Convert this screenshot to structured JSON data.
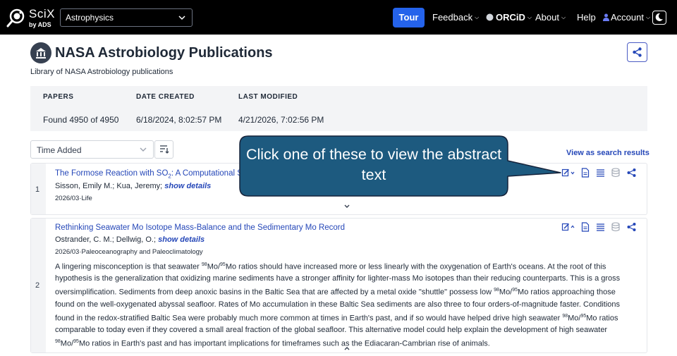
{
  "nav": {
    "logo_title": "SciX",
    "logo_subtitle": "by ADS",
    "discipline": "Astrophysics",
    "tour": "Tour",
    "feedback": "Feedback",
    "orcid": "ORCiD",
    "about": "About",
    "help": "Help",
    "account": "Account"
  },
  "library": {
    "title": "NASA Astrobiology Publications",
    "description": "Library of NASA Astrobiology publications"
  },
  "stats": {
    "papers_label": "PAPERS",
    "papers_value": "Found 4950 of 4950",
    "created_label": "DATE CREATED",
    "created_value": "6/18/2024, 8:02:57 PM",
    "modified_label": "LAST MODIFIED",
    "modified_value": "4/21/2026, 7:02:56 PM"
  },
  "sort": {
    "selected": "Time Added",
    "view_as_search": "View as search results"
  },
  "results": [
    {
      "index": "1",
      "title_pre": "The Formose Reaction with SO",
      "title_sub": "2",
      "title_post": ": A Computational S",
      "authors": "Sisson, Emily M.; Kua, Jeremy;",
      "show_details": "show details",
      "pub": "2026/03·Life"
    },
    {
      "index": "2",
      "title": "Rethinking Seawater Mo Isotope Mass-Balance and the Sedimentary Mo Record",
      "authors": "Ostrander, C. M.; Dellwig, O.;",
      "show_details": "show details",
      "pub": "2026/03·Paleoceanography and Paleoclimatology",
      "abstract_lines": [
        [
          "A lingering misconception is that seawater ",
          "98",
          "Mo/",
          "95",
          "Mo ratios should have increased more or less linearly with the oxygenation of Earth's oceans. At the root of this"
        ],
        [
          "hypothesis is the generalization that oxidizing marine sediments have a stronger affinity for lighter-mass Mo isotopes than their reducing counterparts. This is a gross"
        ],
        [
          "oversimplification. Sediments from deep anoxic basins in the Baltic Sea that are affected by a metal oxide \"shuttle\" possess low ",
          "98",
          "Mo/",
          "95",
          "Mo ratios approaching those"
        ],
        [
          "found on the well-oxygenated abyssal seafloor. Rates of Mo accumulation in these Baltic Sea sediments are also three to four orders-of-magnitude faster. Conditions"
        ],
        [
          "found in the redox-stratified Baltic Sea were probably much more common at times in Earth's past, and if so would have helped drive high seawater ",
          "98",
          "Mo/",
          "95",
          "Mo ratios"
        ],
        [
          "comparable to today even if they covered a small areal fraction of the global seafloor. This alternative model could help explain the development of high seawater"
        ],
        [
          "",
          "98",
          "Mo/",
          "95",
          "Mo ratios in Earth's past and has important implications for timeframes such as the Ediacaran-Cambrian rise of animals."
        ]
      ]
    }
  ],
  "callout": {
    "text": "Click one of these to view the abstract text",
    "fill": "#1d5a7f",
    "stroke": "#15223a"
  },
  "colors": {
    "nav_bg": "#000000",
    "tour_bg": "#2563eb",
    "link": "#2547b8",
    "stats_bg": "#f3f4f6"
  }
}
